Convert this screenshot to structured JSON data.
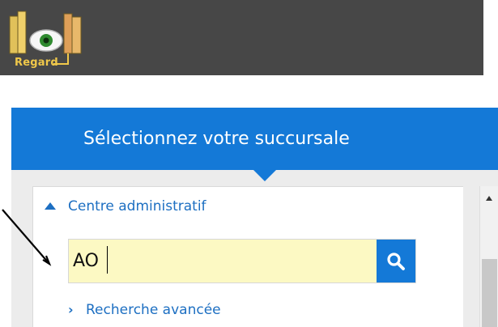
{
  "header": {
    "logo_text": "Regard",
    "logo_icon": "regard-logo-icon"
  },
  "selector": {
    "title": "Sélectionnez votre succursale",
    "centre_link": "Centre administratif",
    "search": {
      "value": "AO",
      "placeholder": "",
      "button_icon": "search-icon"
    },
    "advanced_link": "Recherche avancée"
  },
  "colors": {
    "topbar": "#474747",
    "accent": "#1479d7",
    "link": "#1d6fc2",
    "input_background": "#fcf9c3"
  }
}
